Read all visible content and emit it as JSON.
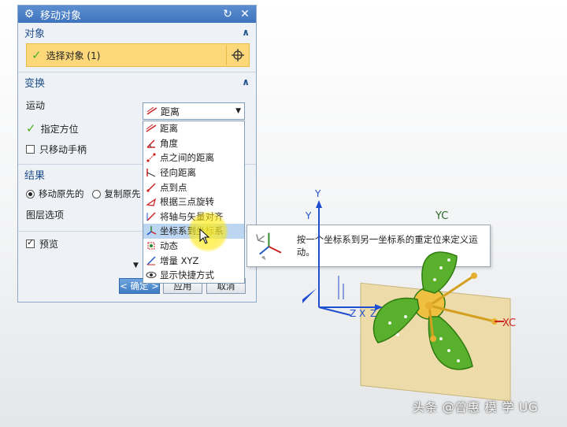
{
  "dialog": {
    "title": "移动对象",
    "object_section": {
      "heading": "对象",
      "select_label": "选择对象 (1)"
    },
    "transform_section": {
      "heading": "变换",
      "motion_label": "运动",
      "motion_value": "距离",
      "specify_orientation": "指定方位",
      "move_handle_only": "只移动手柄"
    },
    "result_section": {
      "heading": "结果",
      "move_original": "移动原先的",
      "copy_original": "复制原先",
      "layer_option": "图层选项"
    },
    "preview_label": "预览",
    "ok_label": "< 确定 >",
    "apply_label": "应用",
    "cancel_label": "取消"
  },
  "dropdown": {
    "items": [
      {
        "label": "距离",
        "icon": "distance-icon"
      },
      {
        "label": "角度",
        "icon": "angle-icon"
      },
      {
        "label": "点之间的距离",
        "icon": "point-distance-icon"
      },
      {
        "label": "径向距离",
        "icon": "radial-distance-icon"
      },
      {
        "label": "点到点",
        "icon": "point-to-point-icon"
      },
      {
        "label": "根据三点旋转",
        "icon": "three-point-rotate-icon"
      },
      {
        "label": "将轴与矢量对齐",
        "icon": "align-axis-icon"
      },
      {
        "label": "坐标系到坐标系",
        "icon": "csys-to-csys-icon"
      },
      {
        "label": "动态",
        "icon": "dynamic-icon"
      },
      {
        "label": "增量 XYZ",
        "icon": "delta-xyz-icon"
      },
      {
        "label": "显示快捷方式",
        "icon": "show-shortcuts-icon"
      }
    ],
    "selected_index": 7
  },
  "tooltip": {
    "text": "按一个坐标系到另一坐标系的重定位来定义运动。"
  },
  "scene": {
    "y_label": "Y",
    "y_label_2": "Y",
    "yc_label": "YC",
    "z_label": "Z",
    "x_label": "X",
    "xc_label": "XC",
    "z_label_2": "Z"
  },
  "watermark": "头条 @曾惠 模 学 UG"
}
